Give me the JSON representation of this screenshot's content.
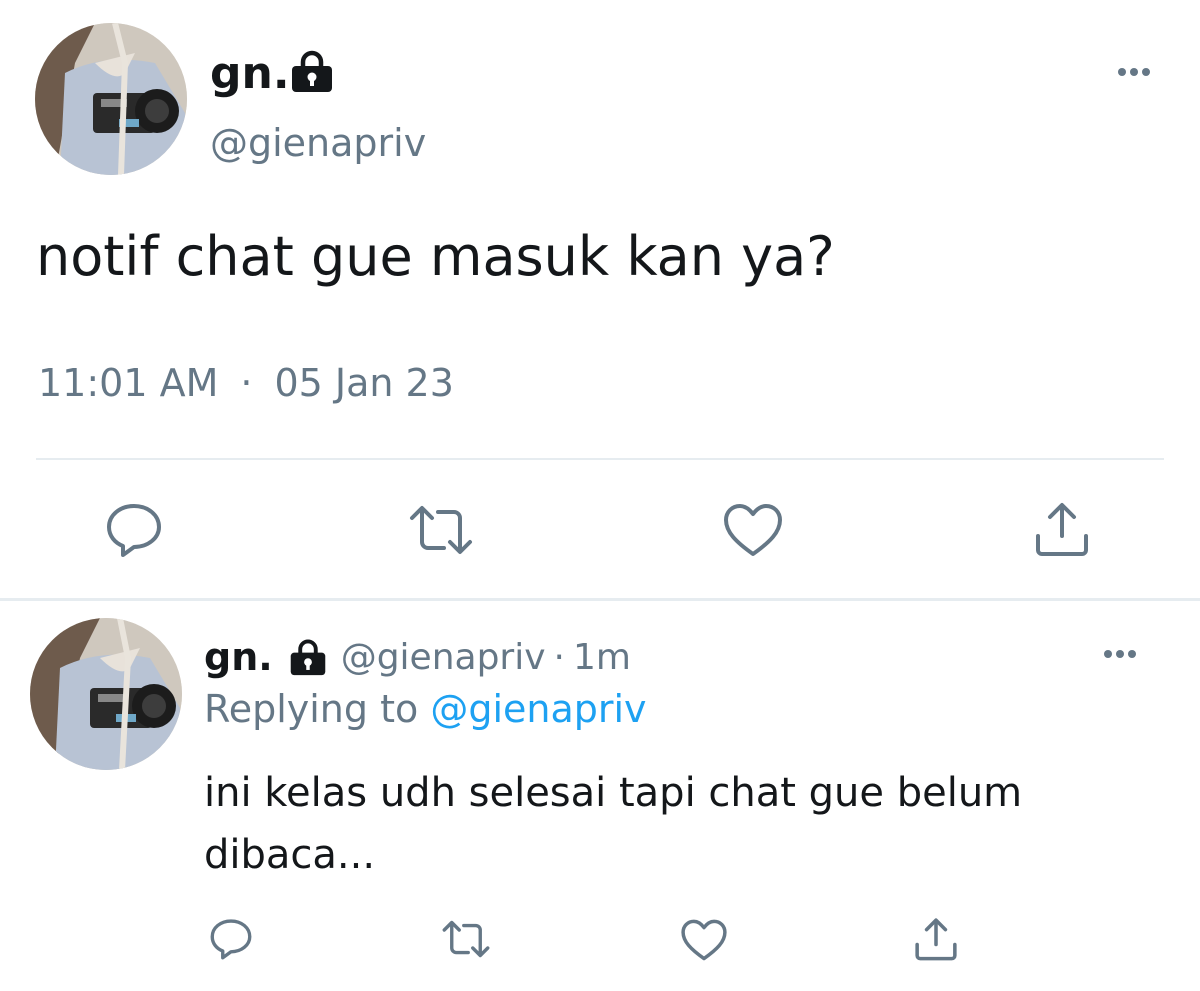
{
  "main_tweet": {
    "display_name": "gn.",
    "handle": "@gienapriv",
    "text": "notif chat gue masuk kan ya?",
    "time": "11:01 AM",
    "separator": "·",
    "date": "05 Jan 23",
    "locked": true
  },
  "reply_tweet": {
    "display_name": "gn.",
    "handle": "@gienapriv",
    "separator": "·",
    "age": "1m",
    "replying_prefix": "Replying to",
    "replying_handle": "@gienapriv",
    "text": "ini kelas udh selesai tapi chat gue belum dibaca...",
    "locked": true
  },
  "icons": {
    "lock": "lock-icon",
    "more": "more-icon",
    "reply": "reply-icon",
    "retweet": "retweet-icon",
    "like": "heart-icon",
    "share": "share-icon"
  },
  "colors": {
    "text": "#14171a",
    "secondary": "#657786",
    "link": "#1da1f2",
    "divider": "#e6ecf0"
  }
}
